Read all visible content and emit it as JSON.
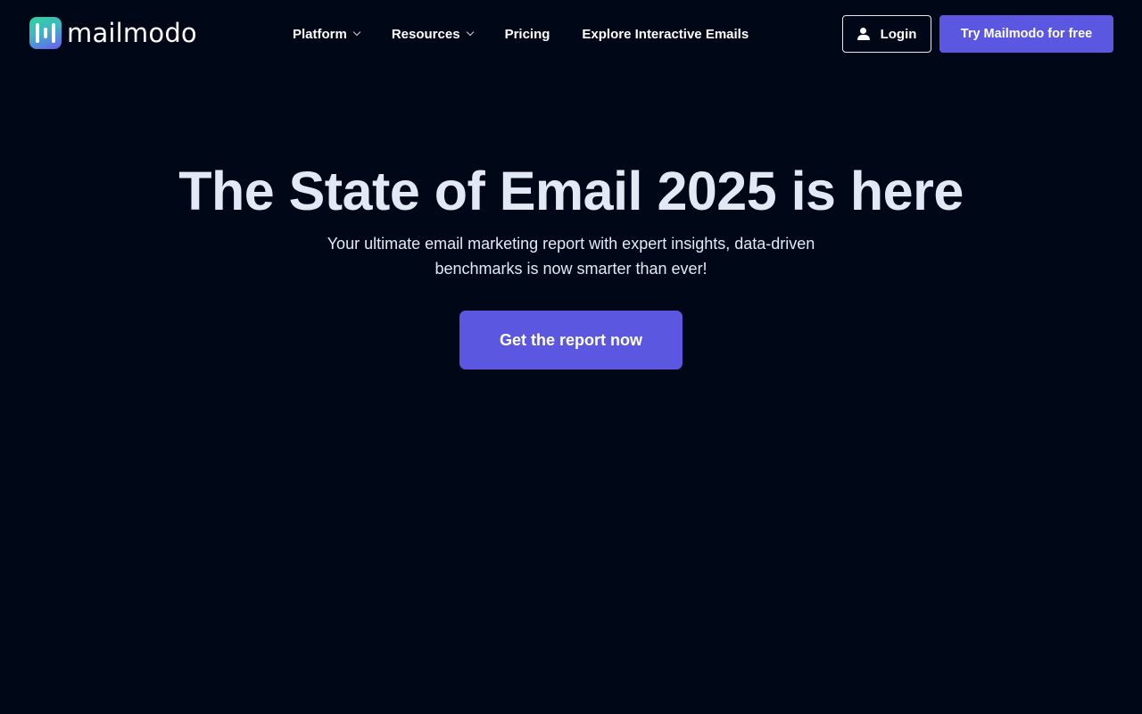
{
  "header": {
    "logo_text": "mailmodo",
    "nav": [
      {
        "label": "Platform",
        "has_dropdown": true
      },
      {
        "label": "Resources",
        "has_dropdown": true
      },
      {
        "label": "Pricing",
        "has_dropdown": false
      },
      {
        "label": "Explore Interactive Emails",
        "has_dropdown": false
      }
    ],
    "login_label": "Login",
    "try_label": "Try Mailmodo for free"
  },
  "hero": {
    "title": "The State of Email 2025 is here",
    "subtitle": "Your ultimate email marketing report with expert insights, data-driven benchmarks is now smarter than ever!",
    "cta_label": "Get the report now"
  },
  "icons": {
    "logo": "mailmodo-logo-icon",
    "dropdown": "chevron-down-icon",
    "user": "user-icon"
  },
  "colors": {
    "background": "#000818",
    "accent": "#5b57e0",
    "heading": "#e3e9f4",
    "text": "#ffffff"
  }
}
